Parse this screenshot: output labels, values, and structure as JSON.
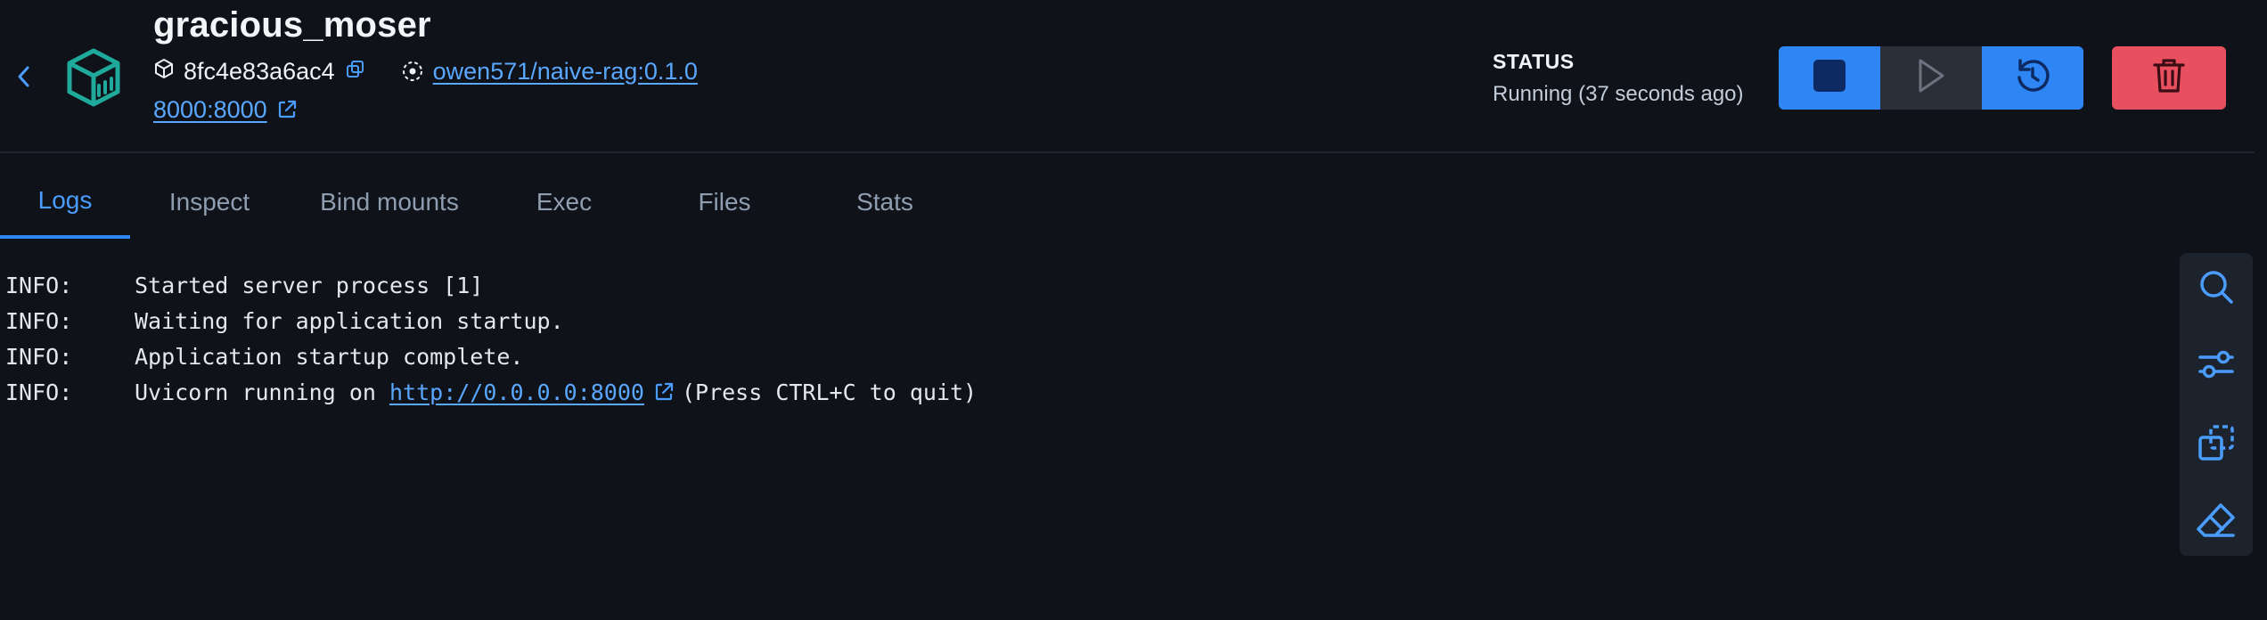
{
  "container": {
    "name": "gracious_moser",
    "id": "8fc4e83a6ac4",
    "image": "owen571/naive-rag:0.1.0",
    "port": "8000:8000"
  },
  "status": {
    "label": "STATUS",
    "value": "Running (37 seconds ago)"
  },
  "icons": {
    "back": "chevron-left-icon",
    "container": "container-box-icon",
    "id": "cube-icon",
    "copy": "copy-icon",
    "image": "image-layers-icon",
    "external": "external-link-icon",
    "stop": "stop-icon",
    "start": "play-icon",
    "restart": "restart-icon",
    "delete": "trash-icon",
    "search": "search-icon",
    "settings": "sliders-icon",
    "copy_all": "copy-dashed-icon",
    "clear": "eraser-icon"
  },
  "tabs": [
    {
      "label": "Logs",
      "active": true
    },
    {
      "label": "Inspect",
      "active": false
    },
    {
      "label": "Bind mounts",
      "active": false
    },
    {
      "label": "Exec",
      "active": false
    },
    {
      "label": "Files",
      "active": false
    },
    {
      "label": "Stats",
      "active": false
    }
  ],
  "logs": [
    {
      "level": "INFO:",
      "text": "Started server process [1]"
    },
    {
      "level": "INFO:",
      "text": "Waiting for application startup."
    },
    {
      "level": "INFO:",
      "text": "Application startup complete."
    },
    {
      "level": "INFO:",
      "text_before": "Uvicorn running on ",
      "link": "http://0.0.0.0:8000",
      "text_after": "(Press CTRL+C to quit)"
    }
  ],
  "colors": {
    "background": "#0f1319",
    "accent": "#2e86f5",
    "link": "#5aa7ff",
    "danger": "#e8505f",
    "brand": "#1fa99a"
  }
}
